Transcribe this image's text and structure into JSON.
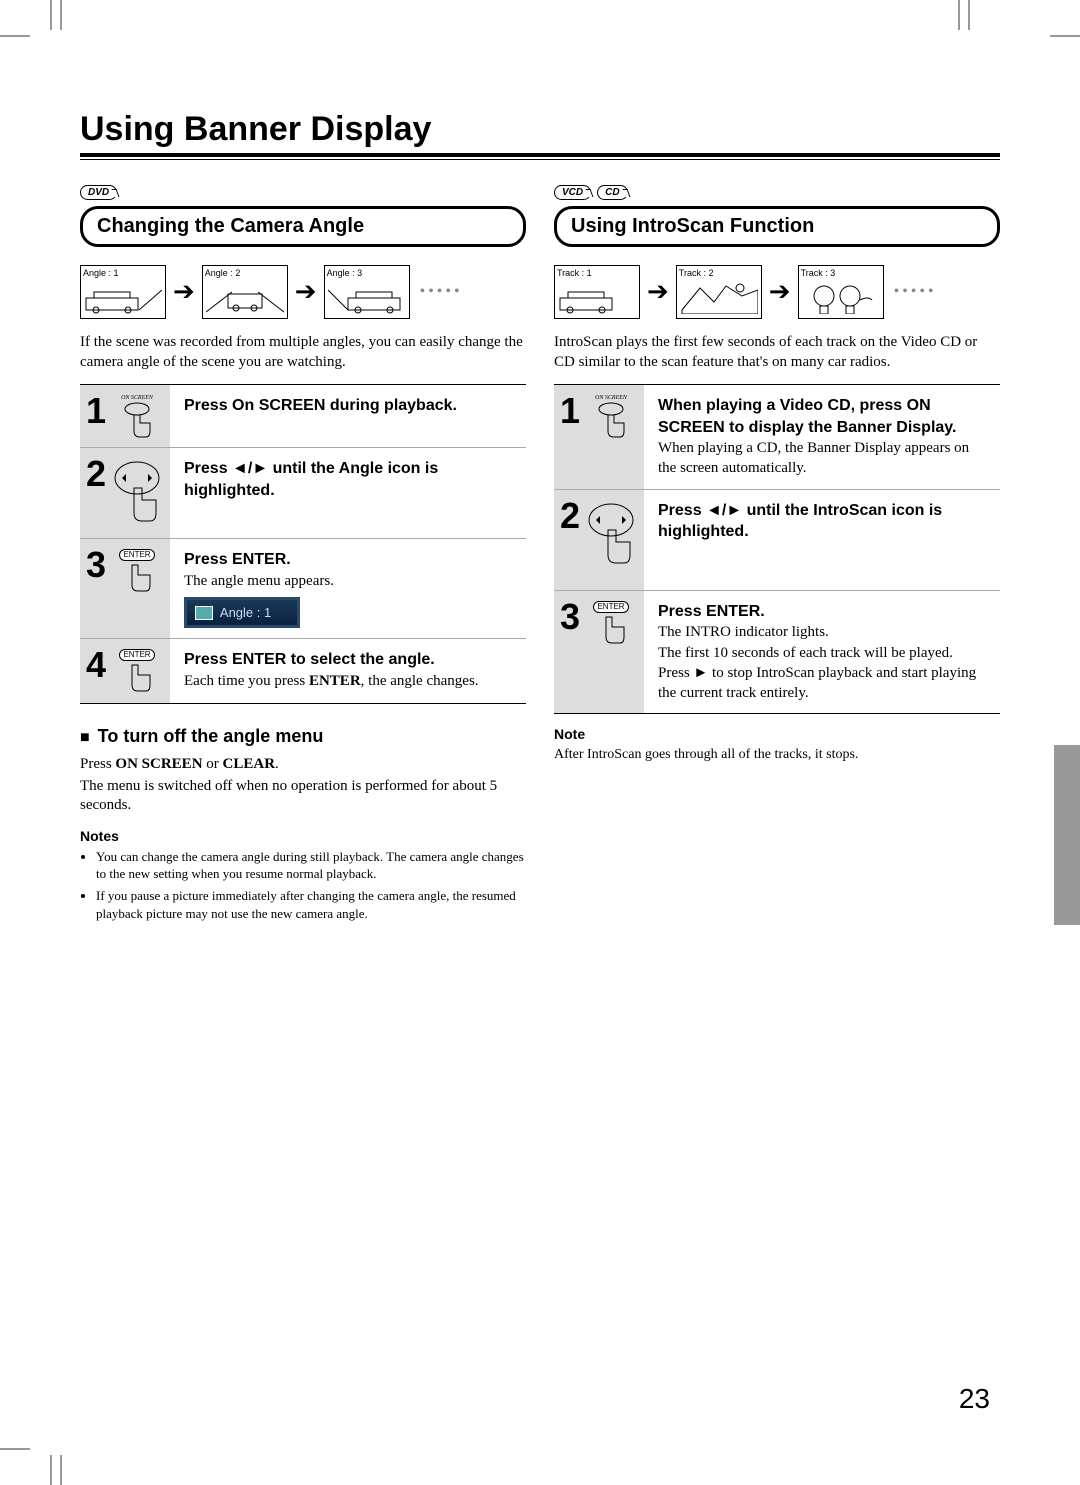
{
  "page_title": "Using Banner Display",
  "page_number": "23",
  "left": {
    "disc_badges": [
      "DVD"
    ],
    "section_title": "Changing the Camera Angle",
    "frames": [
      "Angle : 1",
      "Angle : 2",
      "Angle : 3"
    ],
    "intro": "If the scene was recorded from multiple angles, you can easily change the camera angle of the scene you are watching.",
    "steps": [
      {
        "num": "1",
        "icon_label": "ON SCREEN",
        "title": "Press On SCREEN during playback.",
        "body": ""
      },
      {
        "num": "2",
        "icon_label": "",
        "title_pre": "Press ",
        "title_post": " until the Angle icon is highlighted.",
        "arrows": true
      },
      {
        "num": "3",
        "icon_label": "ENTER",
        "title": "Press ENTER.",
        "body": "The angle menu appears.",
        "screen_text": "Angle : 1"
      },
      {
        "num": "4",
        "icon_label": "ENTER",
        "title": "Press ENTER to select the angle.",
        "body_pre": "Each time you press ",
        "body_bold": "ENTER",
        "body_post": ", the angle changes."
      }
    ],
    "sub_heading": "To turn off the angle menu",
    "sub_text_pre": "Press ",
    "sub_text_bold1": "ON SCREEN",
    "sub_text_mid": " or ",
    "sub_text_bold2": "CLEAR",
    "sub_text_post": ".",
    "sub_text2": "The menu is switched off when no operation is performed for about 5 seconds.",
    "notes_heading": "Notes",
    "notes": [
      "You can change the camera angle during still playback. The camera angle changes to the new setting when you resume normal playback.",
      "If you pause a picture immediately after changing the camera angle, the resumed playback picture may not use the new camera angle."
    ]
  },
  "right": {
    "disc_badges": [
      "VCD",
      "CD"
    ],
    "section_title": "Using IntroScan Function",
    "frames": [
      "Track : 1",
      "Track : 2",
      "Track : 3"
    ],
    "intro": "IntroScan plays the first few seconds of each track on the Video CD or CD similar to the scan feature that's on many car radios.",
    "steps": [
      {
        "num": "1",
        "icon_label": "ON SCREEN",
        "title": "When playing a Video CD, press ON SCREEN to display the Banner Display.",
        "body": "When playing a CD, the Banner Display appears on the screen automatically."
      },
      {
        "num": "2",
        "icon_label": "",
        "title_pre": "Press ",
        "title_post": " until the IntroScan icon is highlighted.",
        "arrows": true
      },
      {
        "num": "3",
        "icon_label": "ENTER",
        "title": "Press ENTER.",
        "body": "The INTRO indicator lights.",
        "body2": "The first 10 seconds of each track will be played.",
        "body3_pre": "Press ",
        "body3_play": true,
        "body3_post": " to stop IntroScan playback and start playing the current track entirely."
      }
    ],
    "notes_heading": "Note",
    "note_single": "After IntroScan goes through all of the tracks, it stops."
  }
}
